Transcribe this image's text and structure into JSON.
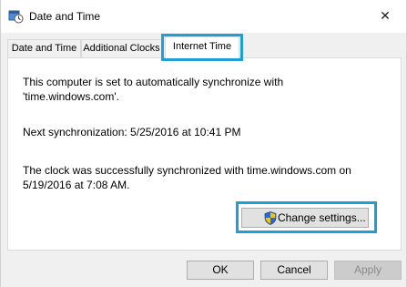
{
  "window": {
    "title": "Date and Time",
    "icon": "date-time-icon",
    "close_glyph": "✕"
  },
  "tabs": [
    {
      "label": "Date and Time",
      "selected": false
    },
    {
      "label": "Additional Clocks",
      "selected": false
    },
    {
      "label": "Internet Time",
      "selected": true
    }
  ],
  "panel": {
    "sync_text_line1": "This computer is set to automatically synchronize with",
    "sync_text_line2": "'time.windows.com'.",
    "next_sync": "Next synchronization: 5/25/2016 at 10:41 PM",
    "result_line1": "The clock was successfully synchronized with time.windows.com on",
    "result_line2": "5/19/2016 at 7:08 AM.",
    "change_settings_label": "Change settings..."
  },
  "buttons": {
    "ok": "OK",
    "cancel": "Cancel",
    "apply": "Apply"
  },
  "colors": {
    "highlight": "#1e9fd8",
    "shield_blue": "#2a6bd1",
    "shield_yellow": "#f5c400"
  }
}
